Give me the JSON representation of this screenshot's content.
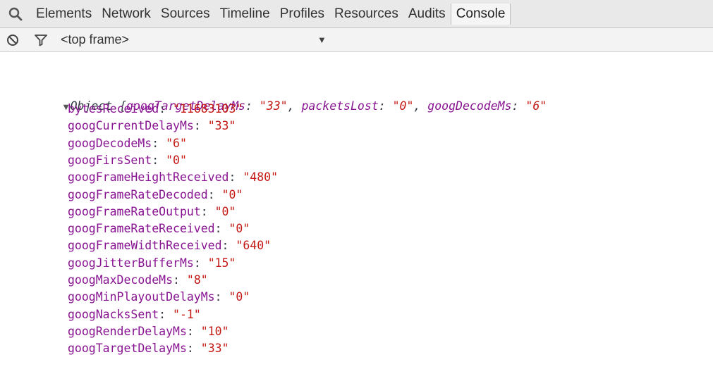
{
  "tabs": [
    "Elements",
    "Network",
    "Sources",
    "Timeline",
    "Profiles",
    "Resources",
    "Audits",
    "Console"
  ],
  "active_tab": "Console",
  "toolbar": {
    "frame_label": "<top frame>",
    "clear_icon": "clear-console-icon",
    "filter_icon": "filter-icon",
    "dropdown_icon": "dropdown-arrow-icon"
  },
  "console": {
    "object_summary": {
      "type": "Object",
      "open_brace": "{",
      "entries": [
        {
          "key": "googTargetDelayMs",
          "value": "\"33\""
        },
        {
          "key": "packetsLost",
          "value": "\"0\""
        },
        {
          "key": "googDecodeMs",
          "value": "\"6\""
        }
      ]
    },
    "properties": [
      {
        "key": "bytesReceived",
        "value": "\"11683103\""
      },
      {
        "key": "googCurrentDelayMs",
        "value": "\"33\""
      },
      {
        "key": "googDecodeMs",
        "value": "\"6\""
      },
      {
        "key": "googFirsSent",
        "value": "\"0\""
      },
      {
        "key": "googFrameHeightReceived",
        "value": "\"480\""
      },
      {
        "key": "googFrameRateDecoded",
        "value": "\"0\""
      },
      {
        "key": "googFrameRateOutput",
        "value": "\"0\""
      },
      {
        "key": "googFrameRateReceived",
        "value": "\"0\""
      },
      {
        "key": "googFrameWidthReceived",
        "value": "\"640\""
      },
      {
        "key": "googJitterBufferMs",
        "value": "\"15\""
      },
      {
        "key": "googMaxDecodeMs",
        "value": "\"8\""
      },
      {
        "key": "googMinPlayoutDelayMs",
        "value": "\"0\""
      },
      {
        "key": "googNacksSent",
        "value": "\"-1\""
      },
      {
        "key": "googRenderDelayMs",
        "value": "\"10\""
      },
      {
        "key": "googTargetDelayMs",
        "value": "\"33\""
      }
    ]
  },
  "colors": {
    "key": "#881391",
    "string": "#c41a16",
    "text": "#303942",
    "tabbar_bg": "#e9e9e9"
  }
}
